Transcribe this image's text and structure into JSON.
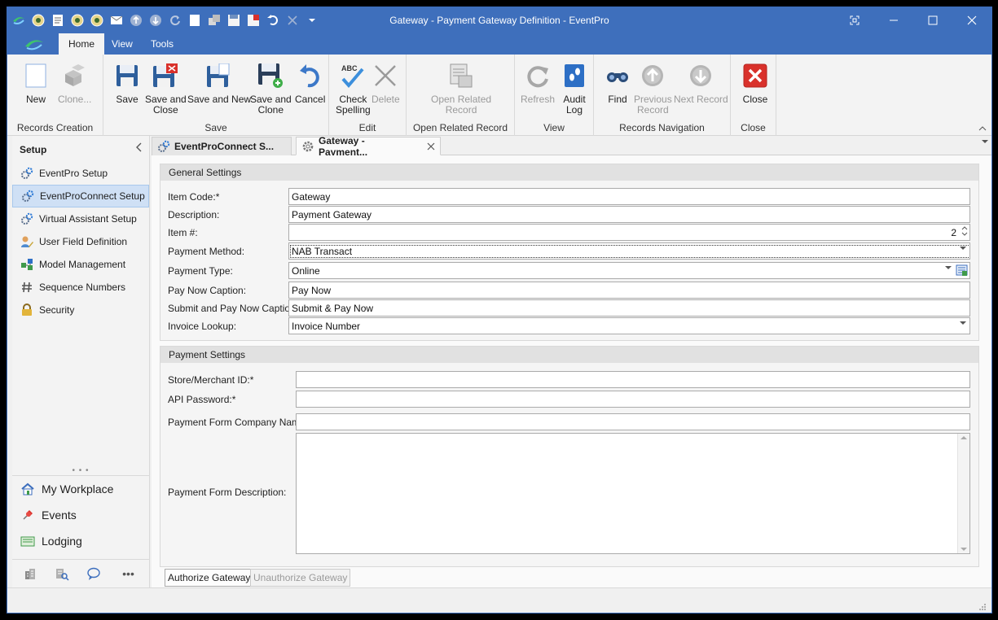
{
  "window": {
    "title": "Gateway - Payment Gateway Definition - EventPro"
  },
  "quick_access": [
    "refresh-icon",
    "back-icon",
    "document-icon",
    "forward-icon",
    "back-alt-icon",
    "mail-icon",
    "up-icon",
    "down-icon",
    "redo-icon",
    "save-new-icon",
    "save-clone-icon",
    "save-icon",
    "save-close-icon",
    "undo-icon",
    "delete-icon",
    "customize-icon"
  ],
  "ribbon_tabs": {
    "home": "Home",
    "view": "View",
    "tools": "Tools"
  },
  "ribbon": {
    "records_creation": {
      "label": "Records Creation",
      "new": "New",
      "clone": "Clone..."
    },
    "save": {
      "label": "Save",
      "save": "Save",
      "save_close": "Save and\nClose",
      "save_new": "Save and New",
      "save_clone": "Save and\nClone",
      "cancel": "Cancel"
    },
    "edit": {
      "label": "Edit",
      "check_spelling": "Check\nSpelling",
      "delete": "Delete"
    },
    "open_related": {
      "label": "Open Related Record",
      "open": "Open Related\nRecord"
    },
    "view": {
      "label": "View",
      "refresh": "Refresh",
      "audit_log": "Audit\nLog"
    },
    "navigation": {
      "label": "Records Navigation",
      "find": "Find",
      "previous": "Previous\nRecord",
      "next": "Next Record"
    },
    "close": {
      "label": "Close",
      "close": "Close"
    }
  },
  "sidebar": {
    "title": "Setup",
    "items": [
      {
        "label": "EventPro Setup"
      },
      {
        "label": "EventProConnect Setup"
      },
      {
        "label": "Virtual Assistant Setup"
      },
      {
        "label": "User Field Definition"
      },
      {
        "label": "Model Management"
      },
      {
        "label": "Sequence Numbers"
      },
      {
        "label": "Security"
      }
    ],
    "nav": [
      {
        "label": "My Workplace"
      },
      {
        "label": "Events"
      },
      {
        "label": "Lodging"
      }
    ],
    "more": "•••"
  },
  "doc_tabs": [
    {
      "label": "EventProConnect S..."
    },
    {
      "label": "Gateway - Payment..."
    }
  ],
  "general": {
    "title": "General Settings",
    "item_code": {
      "label": "Item Code:*",
      "value": "Gateway"
    },
    "description": {
      "label": "Description:",
      "value": "Payment Gateway"
    },
    "item_no": {
      "label": "Item #:",
      "value": "2"
    },
    "payment_method": {
      "label": "Payment Method:",
      "value": "NAB Transact"
    },
    "payment_type": {
      "label": "Payment Type:",
      "value": "Online"
    },
    "pay_now_caption": {
      "label": "Pay Now Caption:",
      "value": "Pay Now"
    },
    "submit_pay_caption": {
      "label": "Submit and Pay Now Caption:",
      "value": "Submit & Pay Now"
    },
    "invoice_lookup": {
      "label": "Invoice Lookup:",
      "value": "Invoice Number"
    }
  },
  "payment": {
    "title": "Payment Settings",
    "merchant_id": {
      "label": "Store/Merchant ID:*",
      "value": ""
    },
    "api_password": {
      "label": "API Password:*",
      "value": ""
    },
    "company_name": {
      "label": "Payment Form Company Name:",
      "value": ""
    },
    "description": {
      "label": "Payment Form Description:",
      "value": ""
    }
  },
  "actions": {
    "authorize": "Authorize Gateway",
    "unauthorize": "Unauthorize Gateway"
  },
  "colors": {
    "titlebar": "#3e6fbc",
    "accent": "#3e6fbc",
    "selected": "#cfe0f5",
    "close_red": "#d9312b"
  }
}
